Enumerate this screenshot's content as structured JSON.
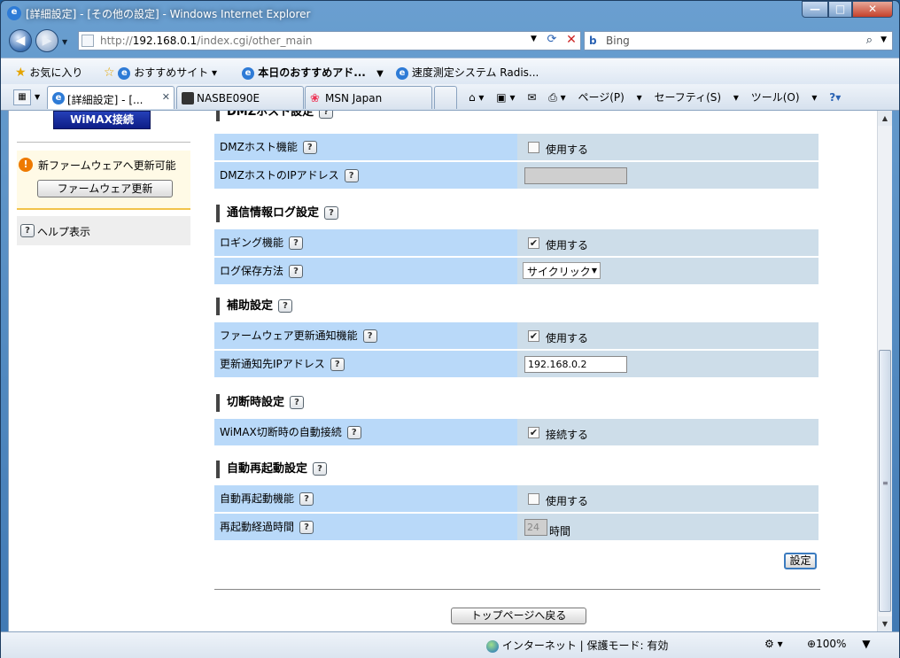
{
  "window": {
    "title": "[詳細設定] - [その他の設定] - Windows Internet Explorer",
    "buttons": {
      "minimize": "—",
      "maximize": "□",
      "close": "✕"
    }
  },
  "address": {
    "url_prefix": "http://",
    "url_host": "192.168.0.1",
    "url_path": "/index.cgi/other_main",
    "search_provider": "Bing"
  },
  "favorites": {
    "label": "お気に入り",
    "items": [
      "おすすめサイト ▾",
      "本日のおすすめアド...",
      "速度測定システム Radis..."
    ]
  },
  "tabs": [
    {
      "label": "[詳細設定] - [...",
      "active": true
    },
    {
      "label": "NASBE090E",
      "active": false
    },
    {
      "label": "MSN Japan",
      "active": false
    }
  ],
  "commands": {
    "page": "ページ(P)",
    "safety": "セーフティ(S)",
    "tools": "ツール(O)"
  },
  "sidebar": {
    "wimax_button": "WiMAX接続",
    "firmware_notice": "新ファームウェアへ更新可能",
    "firmware_button": "ファームウェア更新",
    "help": "ヘルプ表示"
  },
  "sections": {
    "dmz": {
      "title": "DMZホスト設定",
      "rows": {
        "enable_label": "DMZホスト機能",
        "enable_value": "使用する",
        "enable_checked": false,
        "ip_label": "DMZホストのIPアドレス",
        "ip_value": ""
      }
    },
    "log": {
      "title": "通信情報ログ設定",
      "rows": {
        "logging_label": "ロギング機能",
        "logging_value": "使用する",
        "logging_checked": true,
        "method_label": "ログ保存方法",
        "method_value": "サイクリック"
      }
    },
    "aux": {
      "title": "補助設定",
      "rows": {
        "notify_label": "ファームウェア更新通知機能",
        "notify_value": "使用する",
        "notify_checked": true,
        "notify_ip_label": "更新通知先IPアドレス",
        "notify_ip_value": "192.168.0.2"
      }
    },
    "disconnect": {
      "title": "切断時設定",
      "rows": {
        "auto_label": "WiMAX切断時の自動接続",
        "auto_value": "接続する",
        "auto_checked": true
      }
    },
    "reboot": {
      "title": "自動再起動設定",
      "rows": {
        "reboot_label": "自動再起動機能",
        "reboot_value": "使用する",
        "reboot_checked": false,
        "elapsed_label": "再起動経過時間",
        "elapsed_value": "24",
        "elapsed_unit": "時間"
      }
    }
  },
  "buttons": {
    "set": "設定",
    "top": "トップページへ戻る"
  },
  "status": {
    "zone": "インターネット | 保護モード: 有効",
    "zoom": "100%"
  },
  "colors": {
    "label_bg": "#b9d9f9",
    "value_bg": "#cddde9",
    "wimax_button": "#1a2fa0"
  }
}
